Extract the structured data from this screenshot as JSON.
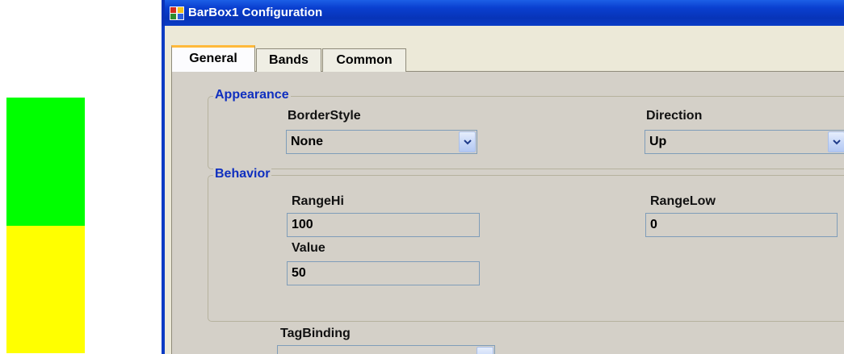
{
  "preview": {
    "colors": {
      "top": "#00ff00",
      "bottom": "#ffff00"
    },
    "fill_fraction": 0.5
  },
  "window": {
    "title": "BarBox1 Configuration",
    "icon": "window-app-icon"
  },
  "tabs": [
    {
      "label": "General",
      "active": true
    },
    {
      "label": "Bands",
      "active": false
    },
    {
      "label": "Common",
      "active": false
    }
  ],
  "appearance": {
    "legend": "Appearance",
    "border_style_label": "BorderStyle",
    "border_style_value": "None",
    "direction_label": "Direction",
    "direction_value": "Up"
  },
  "behavior": {
    "legend": "Behavior",
    "range_hi_label": "RangeHi",
    "range_hi_value": "100",
    "range_low_label": "RangeLow",
    "range_low_value": "0",
    "value_label": "Value",
    "value_value": "50"
  },
  "tag_binding": {
    "label": "TagBinding",
    "value": ""
  },
  "colors": {
    "title_bar": "#0a3fd0",
    "legend_text": "#0f2fbf",
    "active_tab_accent": "#ffb93a",
    "panel": "#d4d0c8"
  }
}
